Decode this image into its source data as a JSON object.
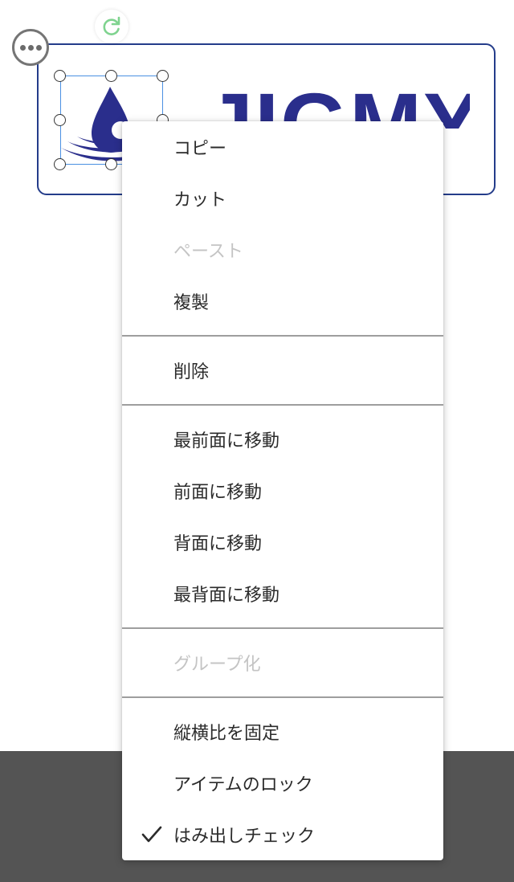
{
  "logo": {
    "wordmark": "JIGMY",
    "brand_color": "#2a2e8c"
  },
  "canvas": {
    "frame_color": "#243c8a",
    "bottom_bar_color": "#545454",
    "selection_color": "#4a90e2",
    "rotate_icon_color": "#7fd38f"
  },
  "context_menu": {
    "items": [
      {
        "label": "コピー",
        "enabled": true
      },
      {
        "label": "カット",
        "enabled": true
      },
      {
        "label": "ペースト",
        "enabled": false
      },
      {
        "label": "複製",
        "enabled": true
      },
      {
        "label": "削除",
        "enabled": true
      },
      {
        "label": "最前面に移動",
        "enabled": true
      },
      {
        "label": "前面に移動",
        "enabled": true
      },
      {
        "label": "背面に移動",
        "enabled": true
      },
      {
        "label": "最背面に移動",
        "enabled": true
      },
      {
        "label": "グループ化",
        "enabled": false
      },
      {
        "label": "縦横比を固定",
        "enabled": true
      },
      {
        "label": "アイテムのロック",
        "enabled": true
      },
      {
        "label": "はみ出しチェック",
        "enabled": true,
        "checked": true
      }
    ]
  },
  "icons": {
    "more": "more-horizontal-icon",
    "rotate": "rotate-icon",
    "check": "check-icon",
    "logo_mark": "water-drop-icon"
  }
}
